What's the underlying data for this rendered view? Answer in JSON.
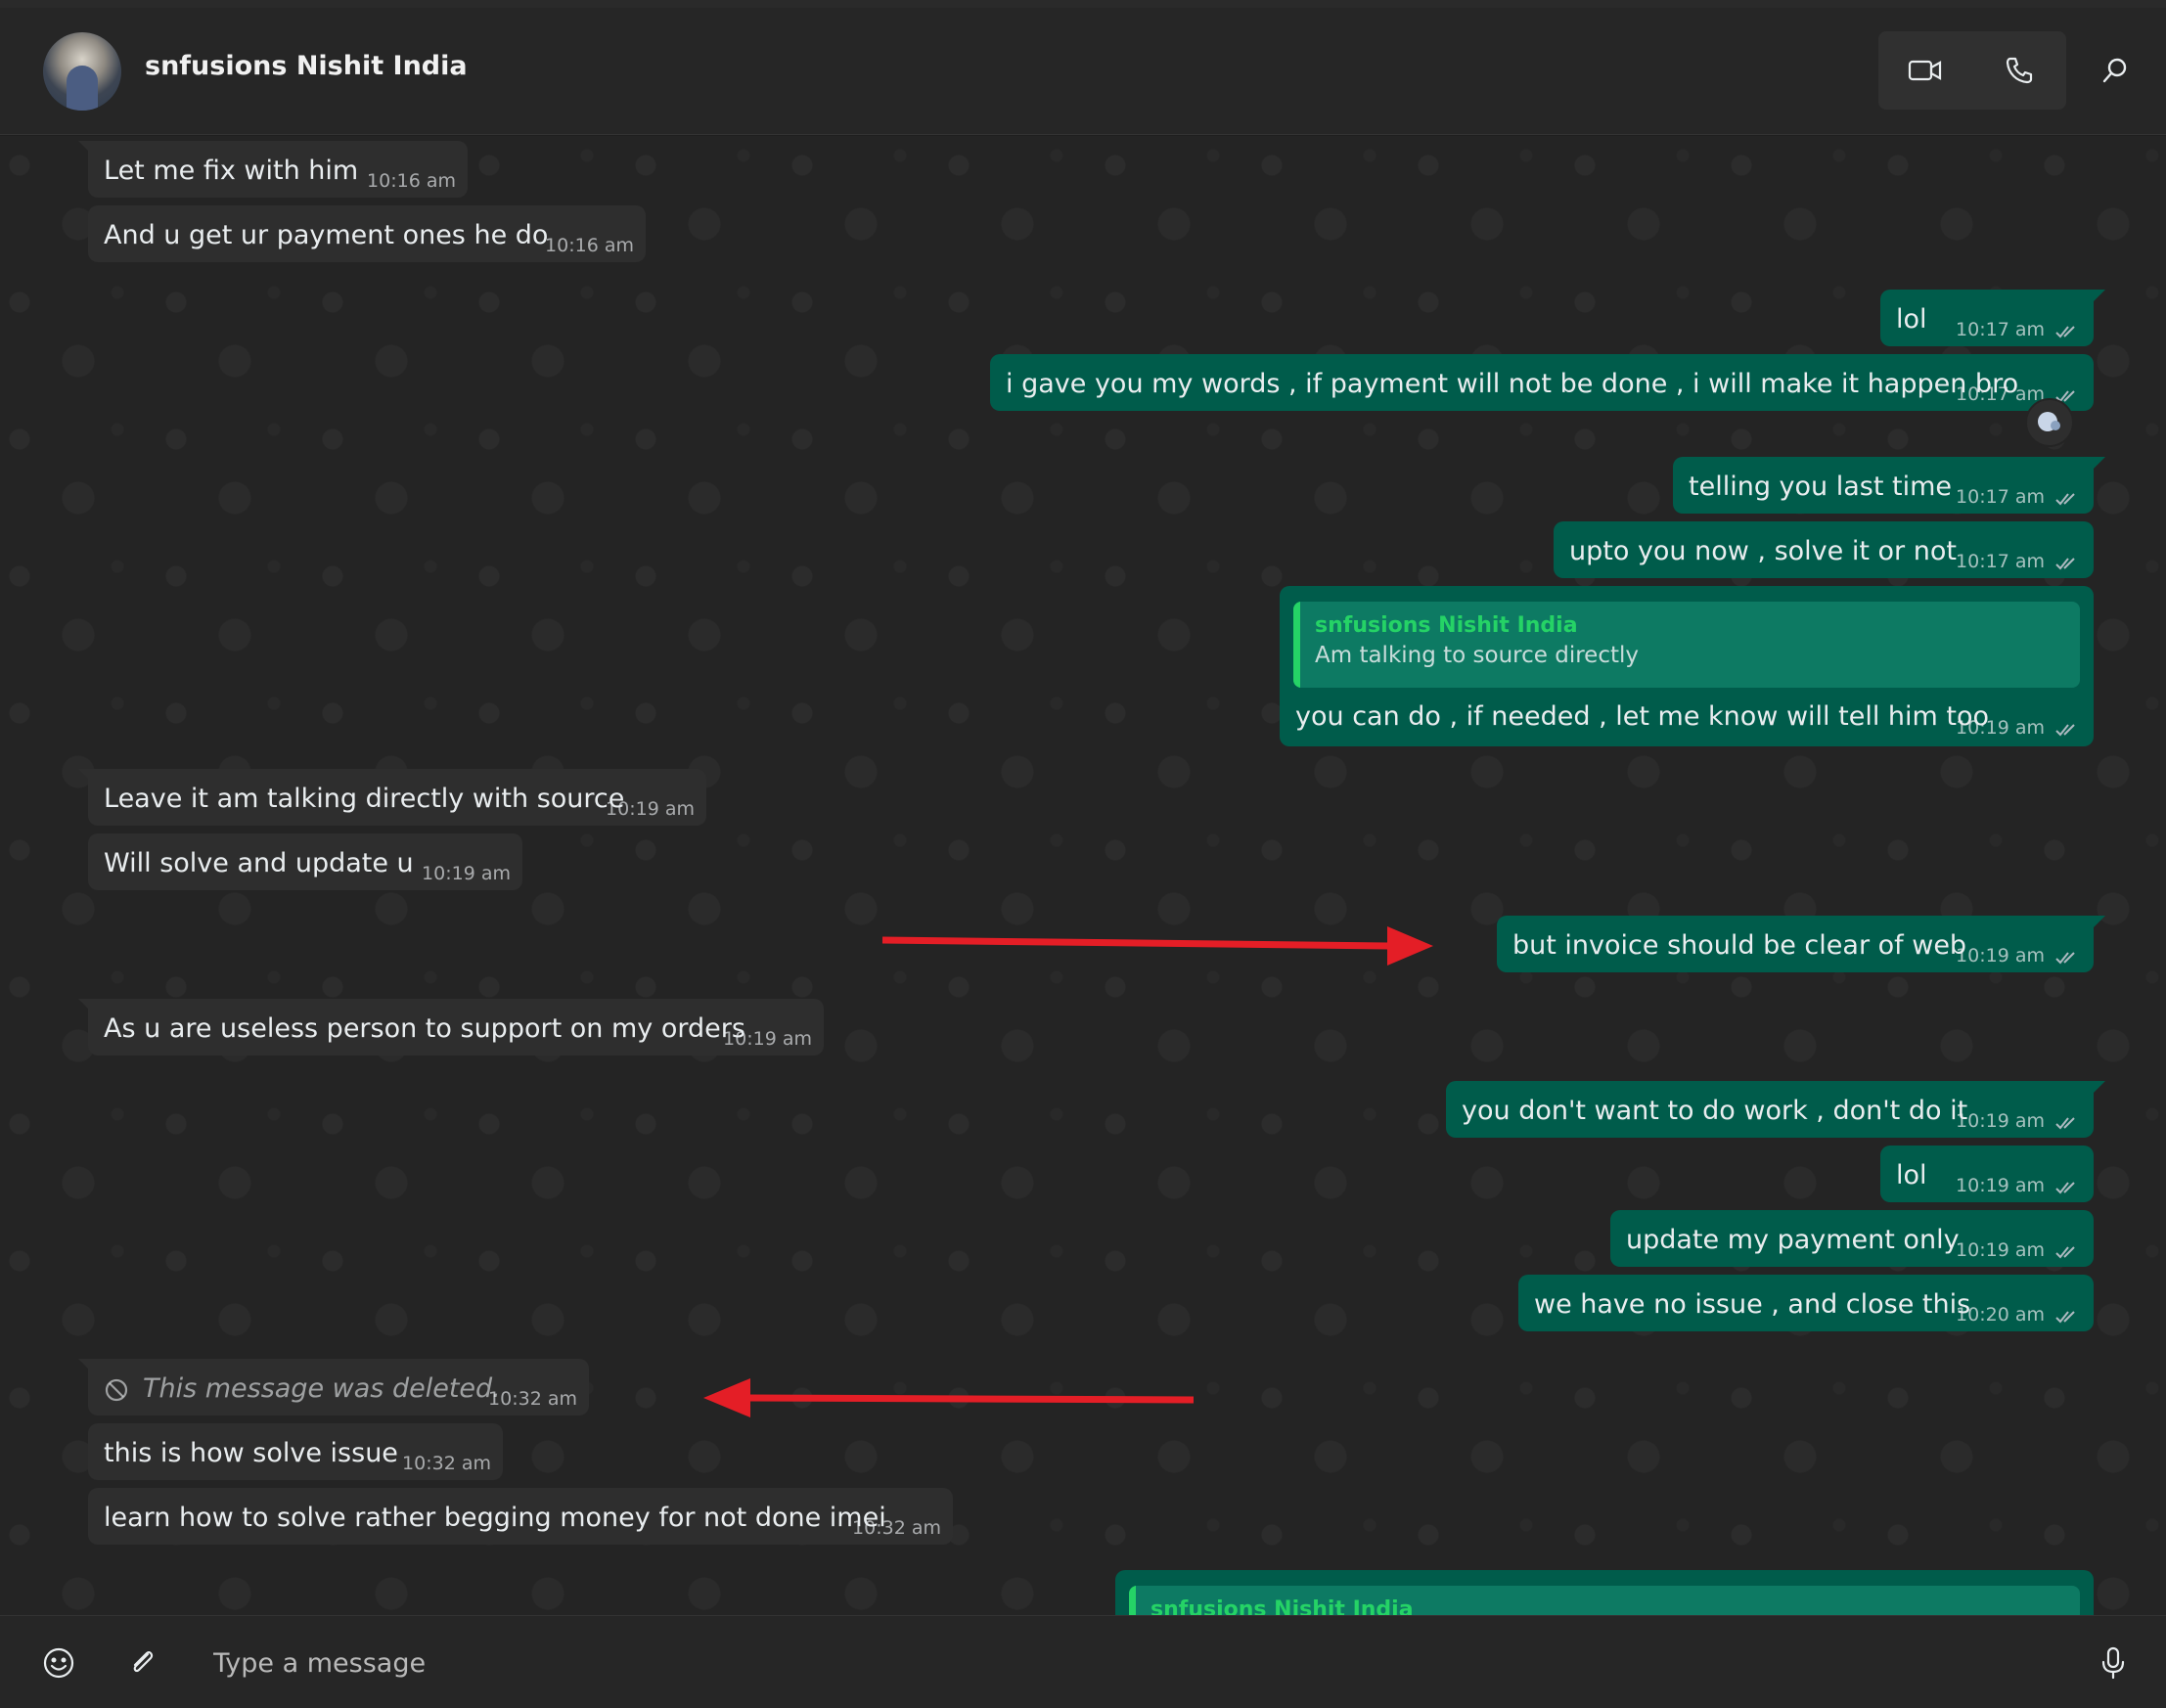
{
  "header": {
    "contact_name": "snfusions Nishit India",
    "icons": [
      "video-call-icon",
      "voice-call-icon",
      "search-icon"
    ]
  },
  "messages": [
    {
      "dir": "in",
      "text": "Let me fix with him",
      "time": "10:16 am"
    },
    {
      "dir": "in",
      "text": "And u get ur payment ones he do",
      "time": "10:16 am"
    },
    {
      "dir": "out",
      "text": "lol",
      "time": "10:17 am"
    },
    {
      "dir": "out",
      "text": "i gave you my words , if payment will not be done , i will make it happen bro",
      "time": "10:17 am"
    },
    {
      "dir": "out",
      "text": "telling you last time",
      "time": "10:17 am"
    },
    {
      "dir": "out",
      "text": "upto you now , solve it or not",
      "time": "10:17 am"
    },
    {
      "dir": "out",
      "quote_author": "snfusions Nishit India",
      "quote_text": "Am talking to source directly",
      "text": "you can do , if needed , let me know will tell him too",
      "time": "10:19 am"
    },
    {
      "dir": "in",
      "text": "Leave it am talking directly with source",
      "time": "10:19 am"
    },
    {
      "dir": "in",
      "text": "Will solve and update u",
      "time": "10:19 am"
    },
    {
      "dir": "out",
      "text": "but invoice should be clear of web",
      "time": "10:19 am"
    },
    {
      "dir": "in",
      "text": "As u are useless person to support on my orders",
      "time": "10:19 am"
    },
    {
      "dir": "out",
      "text": "you don't want to do work , don't do it",
      "time": "10:19 am"
    },
    {
      "dir": "out",
      "text": "lol",
      "time": "10:19 am"
    },
    {
      "dir": "out",
      "text": "update my payment only",
      "time": "10:19 am"
    },
    {
      "dir": "out",
      "text": "we have no issue , and close this",
      "time": "10:20 am"
    },
    {
      "dir": "in",
      "deleted": true,
      "text": "This message was deleted.",
      "time": "10:32 am"
    },
    {
      "dir": "in",
      "text": "this is how solve issue",
      "time": "10:32 am"
    },
    {
      "dir": "in",
      "text": "learn how to solve rather begging money for not done imei",
      "time": "10:32 am"
    },
    {
      "dir": "out",
      "quote_author": "snfusions Nishit India"
    }
  ],
  "composer": {
    "placeholder": "Type a message",
    "icons": [
      "emoji-icon",
      "attach-icon",
      "microphone-icon"
    ]
  },
  "colors": {
    "outgoing_bubble": "#005c4b",
    "incoming_bubble": "#2e2e2e",
    "quote_accent": "#25d366",
    "annotation_arrow": "#e41e26"
  }
}
